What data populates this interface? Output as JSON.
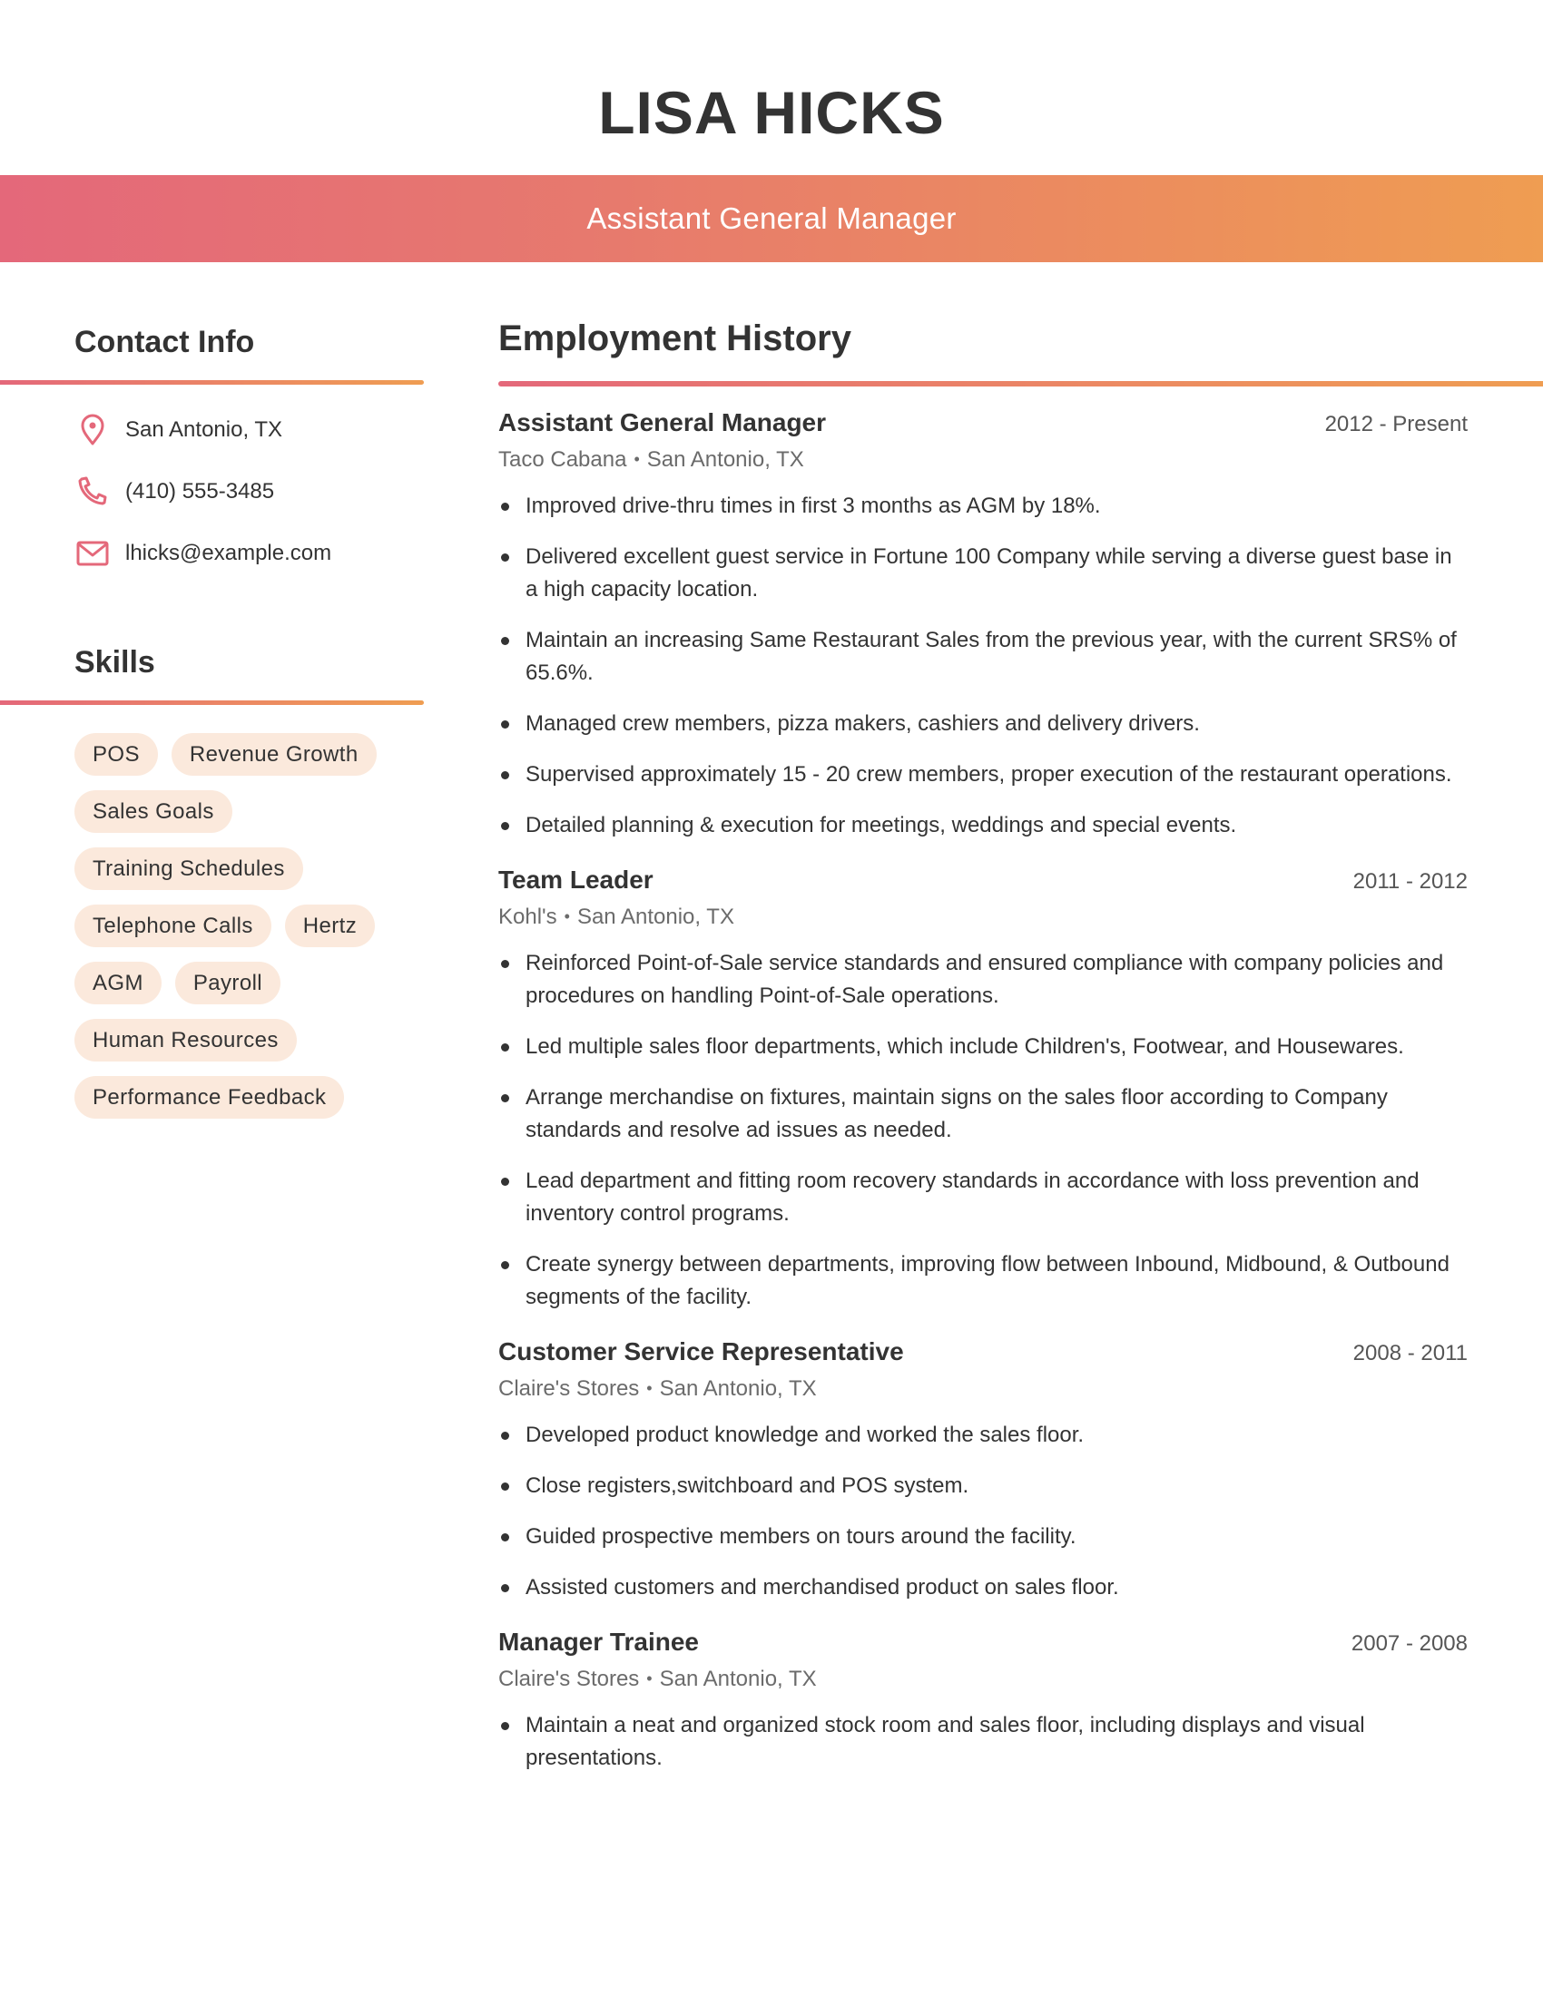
{
  "header": {
    "name": "LISA HICKS",
    "title": "Assistant General Manager"
  },
  "colors": {
    "gradient_start": "#e4687a",
    "gradient_end": "#ef9d52",
    "skill_pill": "#fbe9dc",
    "text": "#333333",
    "muted": "#6b6b6b"
  },
  "contact": {
    "heading": "Contact Info",
    "items": [
      {
        "icon": "map-pin-icon",
        "text": "San Antonio, TX"
      },
      {
        "icon": "phone-icon",
        "text": "(410) 555-3485"
      },
      {
        "icon": "mail-icon",
        "text": "lhicks@example.com"
      }
    ]
  },
  "skills": {
    "heading": "Skills",
    "items": [
      "POS",
      "Revenue Growth",
      "Sales Goals",
      "Training Schedules",
      "Telephone Calls",
      "Hertz",
      "AGM",
      "Payroll",
      "Human Resources",
      "Performance Feedback"
    ]
  },
  "employment": {
    "heading": "Employment History",
    "separator": "•",
    "jobs": [
      {
        "title": "Assistant General Manager",
        "dates": "2012 - Present",
        "company": "Taco Cabana",
        "location": "San Antonio, TX",
        "bullets": [
          "Improved drive-thru times in first 3 months as AGM by 18%.",
          "Delivered excellent guest service in Fortune 100 Company while serving a diverse guest base in a high capacity location.",
          "Maintain an increasing Same Restaurant Sales from the previous year, with the current SRS% of 65.6%.",
          "Managed crew members, pizza makers, cashiers and delivery drivers.",
          "Supervised approximately 15 - 20 crew members, proper execution of the restaurant operations.",
          "Detailed planning & execution for meetings, weddings and special events."
        ]
      },
      {
        "title": "Team Leader",
        "dates": "2011 - 2012",
        "company": "Kohl's",
        "location": "San Antonio, TX",
        "bullets": [
          "Reinforced Point-of-Sale service standards and ensured compliance with company policies and procedures on handling Point-of-Sale operations.",
          "Led multiple sales floor departments, which include Children's, Footwear, and Housewares.",
          "Arrange merchandise on fixtures, maintain signs on the sales floor according to Company standards and resolve ad issues as needed.",
          "Lead department and fitting room recovery standards in accordance with loss prevention and inventory control programs.",
          "Create synergy between departments, improving flow between Inbound, Midbound, & Outbound segments of the facility."
        ]
      },
      {
        "title": "Customer Service Representative",
        "dates": "2008 - 2011",
        "company": "Claire's Stores",
        "location": "San Antonio, TX",
        "bullets": [
          "Developed product knowledge and worked the sales floor.",
          "Close registers,switchboard and POS system.",
          "Guided prospective members on tours around the facility.",
          "Assisted customers and merchandised product on sales floor."
        ]
      },
      {
        "title": "Manager Trainee",
        "dates": "2007 - 2008",
        "company": "Claire's Stores",
        "location": "San Antonio, TX",
        "bullets": [
          "Maintain a neat and organized stock room and sales floor, including displays and visual presentations."
        ]
      }
    ]
  }
}
